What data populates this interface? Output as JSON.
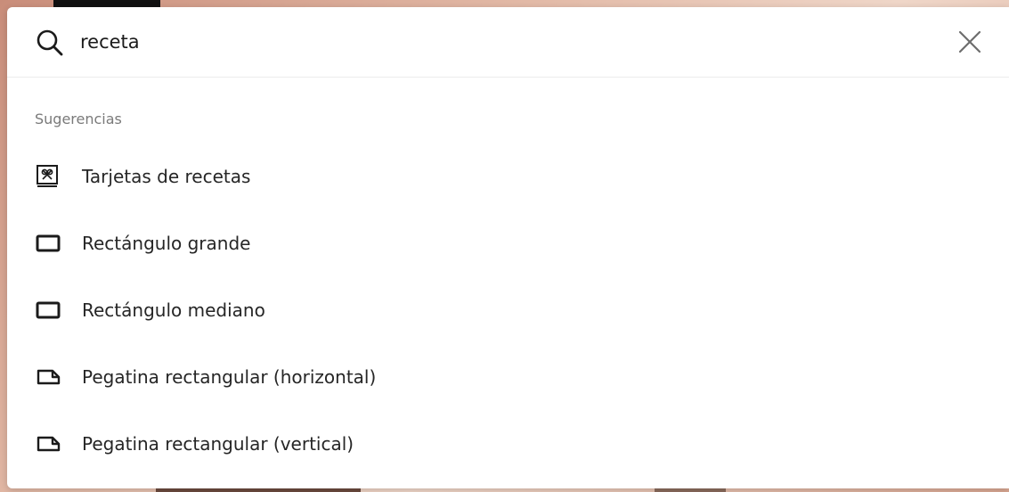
{
  "search": {
    "value": "receta",
    "search_icon": "search-icon",
    "clear_icon": "close-icon"
  },
  "suggestions": {
    "section_title": "Sugerencias",
    "items": [
      {
        "label": "Tarjetas de recetas",
        "icon": "recipe-card-icon"
      },
      {
        "label": "Rectángulo grande",
        "icon": "rectangle-icon"
      },
      {
        "label": "Rectángulo mediano",
        "icon": "rectangle-icon"
      },
      {
        "label": "Pegatina rectangular (horizontal)",
        "icon": "sticker-icon"
      },
      {
        "label": "Pegatina rectangular (vertical)",
        "icon": "sticker-icon"
      }
    ]
  },
  "colors": {
    "text": "#262626",
    "muted": "#7a7a7a",
    "divider": "#ececec"
  }
}
